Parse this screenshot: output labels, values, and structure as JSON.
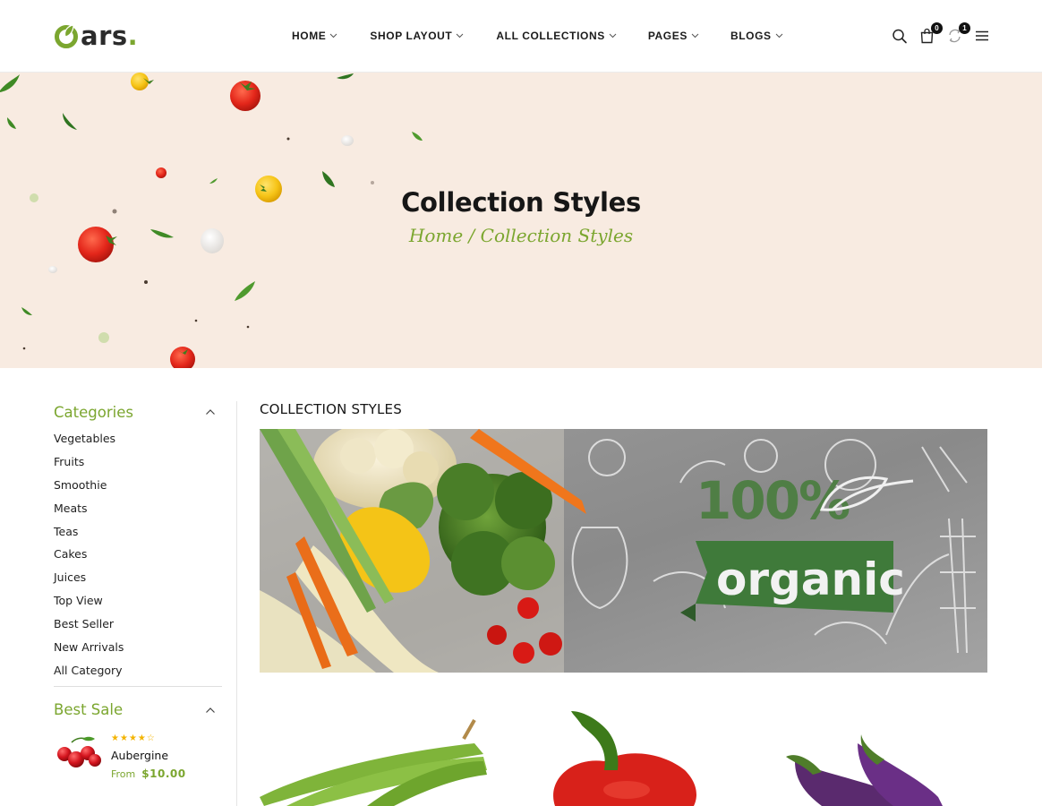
{
  "header": {
    "logo_text": "Oars.",
    "nav": [
      {
        "label": "HOME"
      },
      {
        "label": "SHOP LAYOUT"
      },
      {
        "label": "ALL COLLECTIONS"
      },
      {
        "label": "PAGES"
      },
      {
        "label": "BLOGS"
      }
    ],
    "tools": {
      "search_icon": "search-icon",
      "cart_icon": "bag-icon",
      "cart_count": "0",
      "compare_icon": "compare-icon",
      "compare_count": "1",
      "menu_icon": "hamburger-menu-icon"
    }
  },
  "hero": {
    "title": "Collection Styles",
    "breadcrumb_home": "Home",
    "breadcrumb_sep": " / ",
    "breadcrumb_current": "Collection Styles"
  },
  "sidebar": {
    "categories_title": "Categories",
    "categories": [
      "Vegetables",
      "Fruits",
      "Smoothie",
      "Meats",
      "Teas",
      "Cakes",
      "Juices",
      "Top View",
      "Best Seller",
      "New Arrivals",
      "All Category"
    ],
    "best_sale_title": "Best Sale",
    "best_sale_products": [
      {
        "name": "Aubergine",
        "price_prefix": "From",
        "price": "$10.00",
        "rating": 4,
        "rating_max": 5
      }
    ]
  },
  "main": {
    "section_title": "COLLECTION STYLES",
    "banner": {
      "badge_percent": "100%",
      "badge_word": "organic"
    },
    "products": [
      {
        "image": "green-beans"
      },
      {
        "image": "red-bell-pepper"
      },
      {
        "image": "eggplants"
      }
    ]
  },
  "colors": {
    "accent": "#7ba62f",
    "hero_bg": "#f8ebe1",
    "text_dark": "#161616",
    "star": "#f3b400"
  }
}
